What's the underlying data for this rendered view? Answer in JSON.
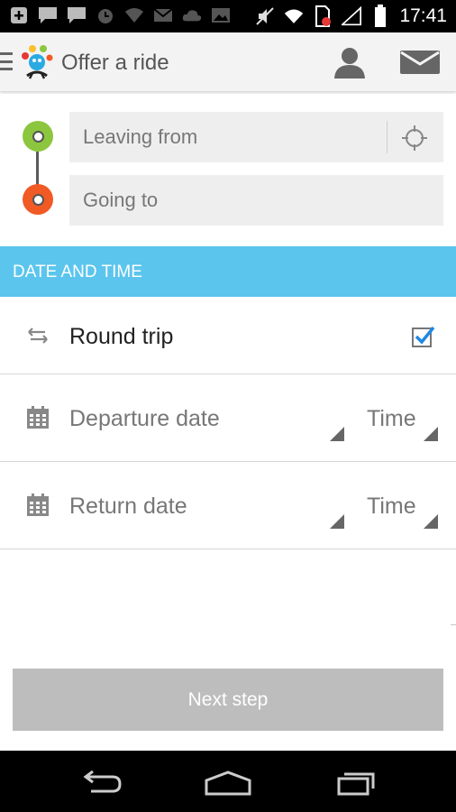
{
  "status_bar": {
    "time": "17:41",
    "icons": [
      "add-box-icon",
      "chat-icon",
      "chat-icon",
      "alarm-icon",
      "wifi-lock-icon",
      "mail-icon",
      "cloud-icon",
      "image-icon",
      "mute-icon",
      "wifi-icon",
      "sim-error-icon",
      "signal-icon",
      "battery-icon"
    ]
  },
  "app_bar": {
    "title": "Offer a ride",
    "icons": [
      "menu-icon",
      "logo",
      "profile-icon",
      "mail-icon"
    ]
  },
  "route": {
    "from_placeholder": "Leaving from",
    "to_placeholder": "Going to",
    "from_pin_color": "#8cc63f",
    "to_pin_color": "#f15a24"
  },
  "date_time_section": {
    "header": "DATE AND TIME",
    "header_color": "#5bc5ee",
    "round_trip": {
      "label": "Round trip",
      "checked": true
    },
    "departure": {
      "date_label": "Departure date",
      "time_label": "Time"
    },
    "return": {
      "date_label": "Return date",
      "time_label": "Time"
    }
  },
  "actions": {
    "next_step": "Next step",
    "next_step_color": "#bdbdbd"
  },
  "nav_bar": {
    "buttons": [
      "back-icon",
      "home-icon",
      "recent-apps-icon"
    ]
  }
}
